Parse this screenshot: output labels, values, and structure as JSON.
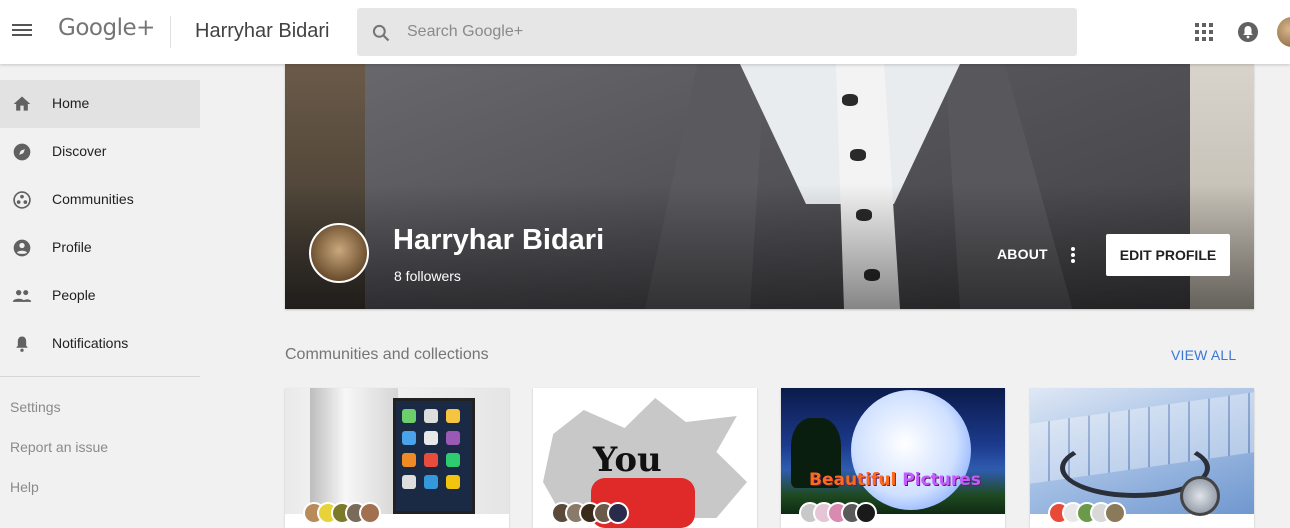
{
  "header": {
    "logo_text": "Google+",
    "page_title": "Harryhar Bidari",
    "search_placeholder": "Search Google+"
  },
  "sidebar": {
    "items": [
      {
        "label": "Home",
        "icon": "home-icon",
        "active": true
      },
      {
        "label": "Discover",
        "icon": "compass-icon",
        "active": false
      },
      {
        "label": "Communities",
        "icon": "communities-icon",
        "active": false
      },
      {
        "label": "Profile",
        "icon": "account-circle-icon",
        "active": false
      },
      {
        "label": "People",
        "icon": "people-icon",
        "active": false
      },
      {
        "label": "Notifications",
        "icon": "bell-icon",
        "active": false
      }
    ],
    "links": [
      "Settings",
      "Report an issue",
      "Help"
    ]
  },
  "profile": {
    "name": "Harryhar Bidari",
    "followers": "8 followers",
    "about_label": "ABOUT",
    "edit_label": "EDIT PROFILE"
  },
  "communities": {
    "title": "Communities and collections",
    "view_all": "VIEW ALL",
    "cards": [
      {
        "art": "phone-image"
      },
      {
        "art": "youtube-image",
        "text": "You"
      },
      {
        "art": "moonlight-couple-image",
        "text": "Beautiful Pictures"
      },
      {
        "art": "stethoscope-keyboard-image"
      }
    ]
  },
  "colors": {
    "accent_link": "#3a77d8",
    "active_nav_bg": "#e2e2e2",
    "search_bg": "#e6e6e6"
  }
}
